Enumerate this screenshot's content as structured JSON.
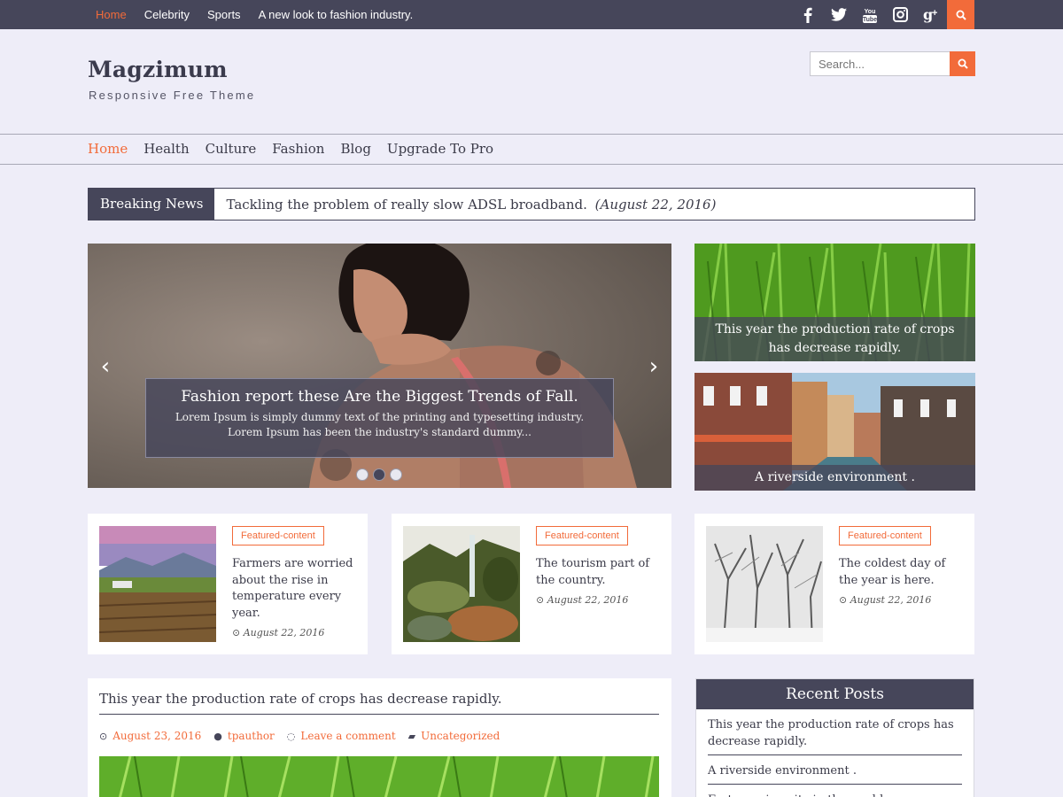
{
  "topnav": {
    "items": [
      "Home",
      "Celebrity",
      "Sports",
      "A new look to fashion industry."
    ]
  },
  "social": {
    "icons": [
      "facebook-icon",
      "twitter-icon",
      "youtube-icon",
      "instagram-icon",
      "google-plus-icon",
      "search-icon"
    ],
    "facebook": "f",
    "twitter": "t",
    "youtube": "You Tube",
    "googleplus": "g+"
  },
  "header": {
    "title": "Magzimum",
    "description": "Responsive Free Theme",
    "search_placeholder": "Search..."
  },
  "mainnav": {
    "items": [
      "Home",
      "Health",
      "Culture",
      "Fashion",
      "Blog",
      "Upgrade To Pro"
    ]
  },
  "breaking": {
    "label": "Breaking News",
    "text": "Tackling the problem of really slow ADSL broadband.",
    "date": "(August 22, 2016)"
  },
  "slider": {
    "title": "Fashion report these Are the Biggest Trends of Fall.",
    "description": "Lorem Ipsum is simply dummy text of the printing and typesetting industry. Lorem Ipsum has been the industry's standard dummy...",
    "prev": "‹",
    "next": "›"
  },
  "side": {
    "first": "This year the production rate of crops has decrease rapidly.",
    "second": "A riverside environment ."
  },
  "cards": [
    {
      "tag": "Featured-content",
      "title": "Farmers are worried about the rise in temperature every year.",
      "date": "August 22, 2016"
    },
    {
      "tag": "Featured-content",
      "title": "The tourism part of the country.",
      "date": "August 22, 2016"
    },
    {
      "tag": "Featured-content",
      "title": "The coldest day of the year is here.",
      "date": "August 22, 2016"
    }
  ],
  "post": {
    "title": "This year the production rate of crops has decrease rapidly.",
    "date": "August 23, 2016",
    "author": "tpauthor",
    "comment": "Leave a comment",
    "category": "Uncategorized"
  },
  "recent": {
    "heading": "Recent Posts",
    "items": [
      "This year the production rate of crops has decrease rapidly.",
      "A riverside environment .",
      "Fast growing city in the world."
    ]
  },
  "colors": {
    "accent": "#f26b3a",
    "dark": "#46465a",
    "background": "#eeedf8"
  }
}
